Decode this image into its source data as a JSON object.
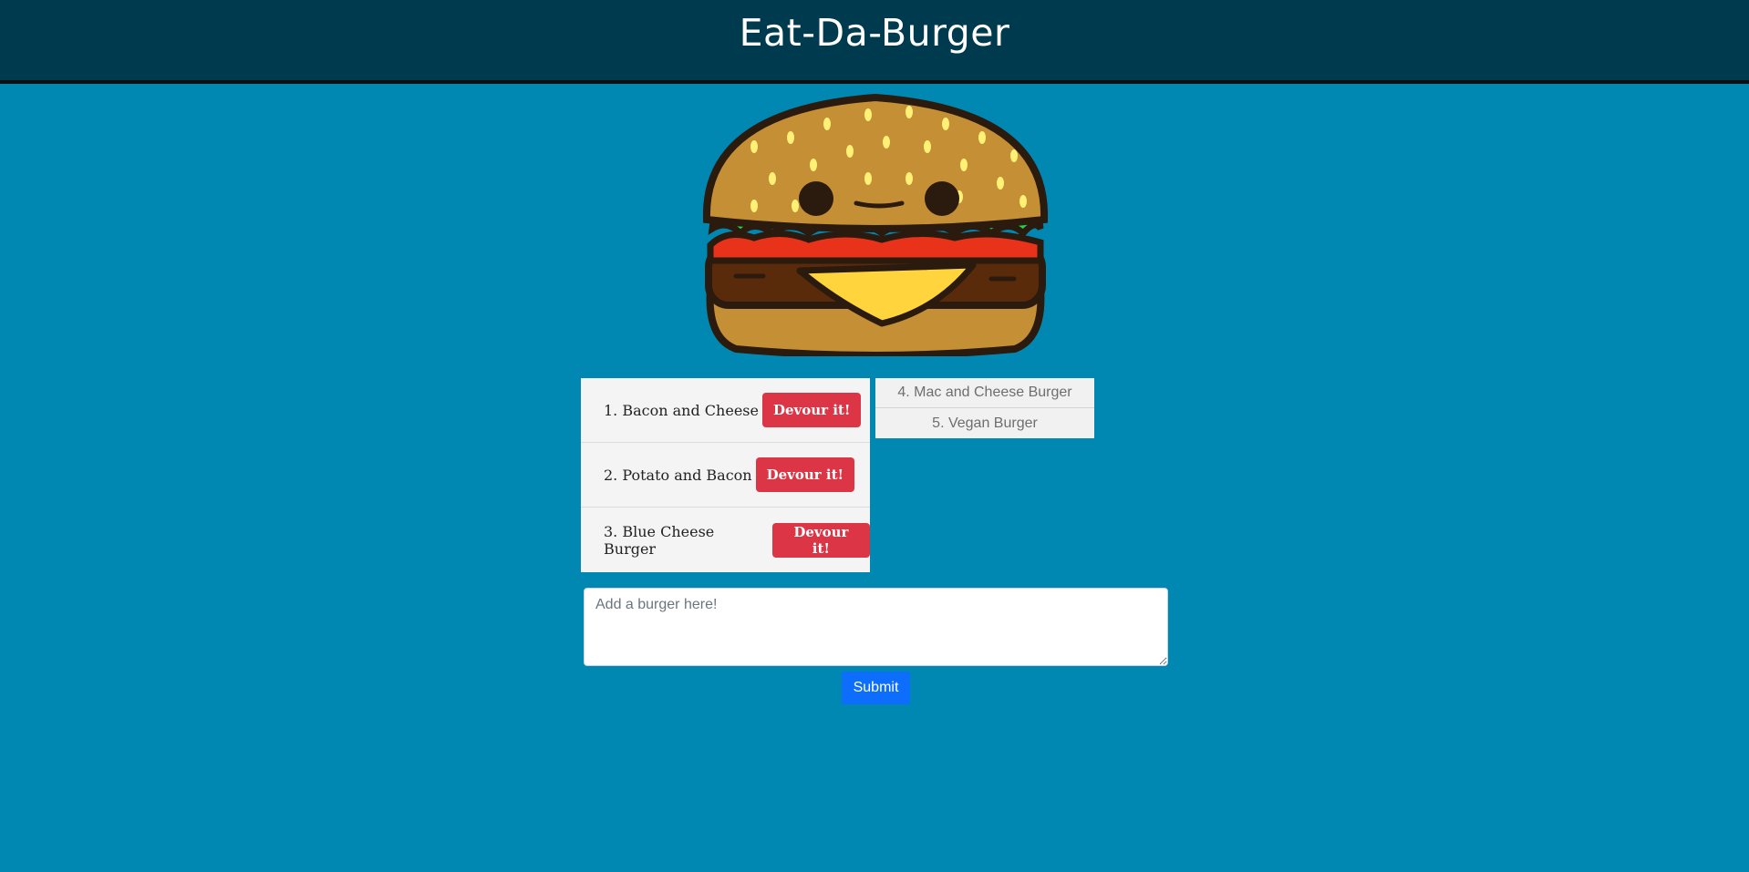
{
  "header": {
    "title": "Eat-Da-Burger"
  },
  "mascot": {
    "icon": "burger-mascot-icon"
  },
  "uneaten_burgers": [
    {
      "label": "1. Bacon and Cheese",
      "button": "Devour it!"
    },
    {
      "label": "2. Potato and Bacon",
      "button": "Devour it!"
    },
    {
      "label": "3. Blue Cheese Burger",
      "button": "Devour it!"
    }
  ],
  "devoured_burgers": [
    {
      "label": "4. Mac and Cheese Burger"
    },
    {
      "label": "5. Vegan Burger"
    }
  ],
  "form": {
    "placeholder": "Add a burger here!",
    "value": "",
    "submit_label": "Submit"
  },
  "colors": {
    "page_background": "#0188b2",
    "header_background": "#003a4e",
    "devour_button": "#dc3545",
    "submit_button": "#0d6efd"
  }
}
